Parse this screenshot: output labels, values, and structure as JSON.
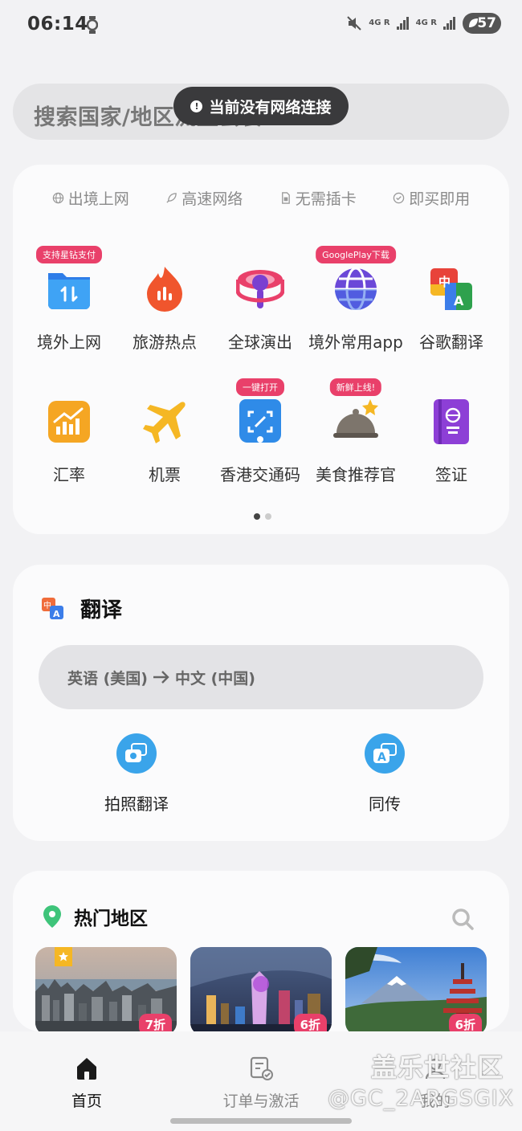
{
  "status_bar": {
    "time": "06:14",
    "network_1": "4G R",
    "network_2": "4G R",
    "battery": "57"
  },
  "search": {
    "placeholder": "搜索国家/地区流量套餐"
  },
  "toast": {
    "text": "当前没有网络连接"
  },
  "features": [
    {
      "icon": "globe-icon",
      "label": "出境上网"
    },
    {
      "icon": "rocket-icon",
      "label": "高速网络"
    },
    {
      "icon": "sim-icon",
      "label": "无需插卡"
    },
    {
      "icon": "check-circle-icon",
      "label": "即买即用"
    }
  ],
  "services_row1": [
    {
      "label": "境外上网",
      "badge": "支持星钻支付",
      "icon": "folder-data-icon"
    },
    {
      "label": "旅游热点",
      "badge": "",
      "icon": "flame-icon"
    },
    {
      "label": "全球演出",
      "badge": "",
      "icon": "microphone-icon"
    },
    {
      "label": "境外常用app",
      "badge": "GooglePlay下载",
      "icon": "globe-app-icon"
    },
    {
      "label": "谷歌翻译",
      "badge": "",
      "icon": "google-translate-icon"
    }
  ],
  "services_row2": [
    {
      "label": "汇率",
      "badge": "",
      "icon": "exchange-chart-icon"
    },
    {
      "label": "机票",
      "badge": "",
      "icon": "airplane-icon"
    },
    {
      "label": "香港交通码",
      "badge": "一键打开",
      "icon": "scan-code-icon"
    },
    {
      "label": "美食推荐官",
      "badge": "新鲜上线!",
      "icon": "food-cloche-icon"
    },
    {
      "label": "签证",
      "badge": "",
      "icon": "passport-icon"
    }
  ],
  "translate": {
    "title": "翻译",
    "source_lang": "英语 (美国)",
    "target_lang": "中文 (中国)",
    "tools": [
      {
        "label": "拍照翻译",
        "icon": "camera-translate-icon"
      },
      {
        "label": "同传",
        "icon": "simultaneous-translate-icon"
      }
    ]
  },
  "hot_regions": {
    "title": "热门地区",
    "destinations": [
      {
        "discount": "7折",
        "image": "hong-kong-skyline"
      },
      {
        "discount": "6折",
        "image": "macau-night"
      },
      {
        "discount": "6折",
        "image": "japan-fuji-pagoda"
      }
    ]
  },
  "bottom_nav": [
    {
      "label": "首页",
      "icon": "home-icon",
      "active": true
    },
    {
      "label": "订单与激活",
      "icon": "order-icon",
      "active": false
    },
    {
      "label": "我的",
      "icon": "profile-icon",
      "active": false
    }
  ],
  "watermark": {
    "brand": "盖乐世社区",
    "user": "@GC_2ARGSGIX"
  },
  "colors": {
    "badge_pink": "#e9406a",
    "accent_blue": "#3aa4ea",
    "card_bg": "#fbfbfc",
    "page_bg": "#f2f2f4"
  }
}
